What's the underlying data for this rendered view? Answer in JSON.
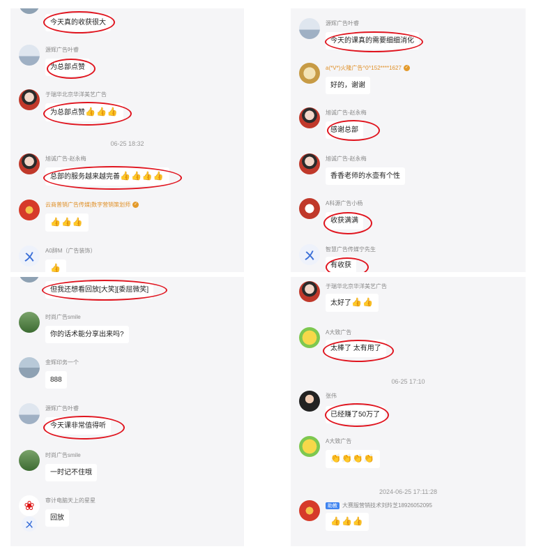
{
  "p1": {
    "m0": "今天真的收获很大",
    "m1_name": "源辉广告叶睿",
    "m1": "为总部点赞",
    "m2_name": "于瑞华北京华洋美艺广告",
    "m2": "为总部点赞",
    "time": "06-25 18:32",
    "m3_name": "旭诚广告-赵永梅",
    "m3": "总部的服务越来越完善",
    "m4_name": "云商普销广告传媒|数字营销策划师",
    "m5_name": "A0辞M（广告装饰）"
  },
  "p2": {
    "m1_name": "源辉广告叶睿",
    "m1": "今天的课真的需要细细消化",
    "m2_name": "a(*V*)火隆广告^0^152****1627",
    "m2": "好的，谢谢",
    "m3_name": "旭诚广告-赵永梅",
    "m3": "感谢总部",
    "m4_name": "旭诚广告-赵永梅",
    "m4": "香香老师的水壶有个性",
    "m5_name": "A科源广告小杨",
    "m5": "收获满满",
    "m6_name": "智慧广告传媒宁先生",
    "m6": "有收获"
  },
  "p3": {
    "m0": "但我还想看回放[大笑][委屈微笑]",
    "m1_name": "时尚广告smile",
    "m1": "你的话术能分享出来吗?",
    "m2_name": "金辉印务一个",
    "m2": "888",
    "m3_name": "源辉广告叶睿",
    "m3": "今天课非常值得听",
    "m4_name": "时尚广告smile",
    "m4": "一时记不住哦",
    "m5_name": "审计电脑天上的星星",
    "m5": "回放"
  },
  "p4": {
    "m1_name": "于瑞华北京华洋美艺广告",
    "m1": "太好了",
    "m2_name": "A大致广告",
    "m2": "太棒了 太有用了",
    "time1": "06-25 17:10",
    "m3_name": "张伟",
    "m3": "已经赚了50万了",
    "m4_name": "A大致广告",
    "time2": "2024-06-25 17:11:28",
    "m5_tag": "助教",
    "m5_name": "大赛服营销技术刘羚芝18926052095"
  },
  "icons": {
    "thumbs": "👍",
    "clap": "👏",
    "badge": "✓",
    "contact": "ㄨ"
  }
}
